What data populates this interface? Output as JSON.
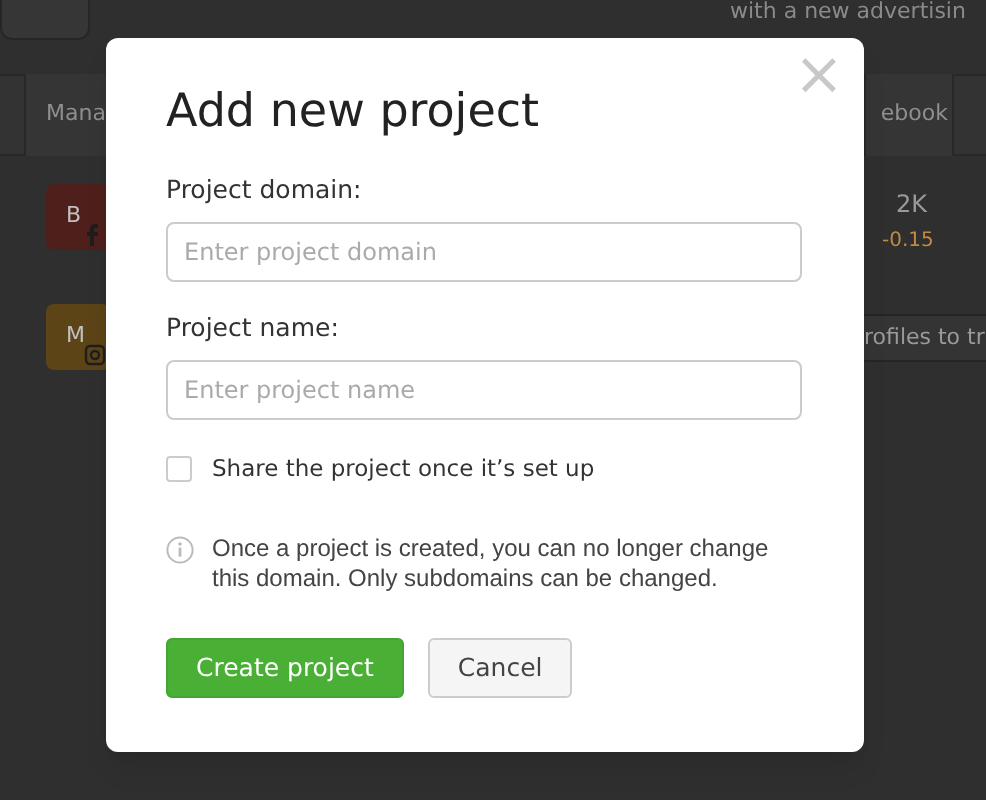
{
  "background": {
    "banner_text": "with a new advertisin",
    "tabs": [
      "Mana",
      "ebook"
    ],
    "rows": [
      {
        "badge": "B",
        "color": "#4f201b",
        "kind": "facebook",
        "value": "2K",
        "change": "-0.15"
      },
      {
        "badge": "M",
        "color": "#5c4417",
        "kind": "instagram",
        "button": "rofiles to tr"
      }
    ]
  },
  "dialog": {
    "title": "Add new project",
    "close": "×",
    "fields": [
      {
        "label": "Project domain:",
        "placeholder": "Enter project domain"
      },
      {
        "label": "Project name:",
        "placeholder": "Enter project name"
      }
    ],
    "share": {
      "label": "Share the project once it’s set up",
      "checked": false
    },
    "note": "Once a project is created, you can no longer change this domain. Only subdomains can be changed.",
    "buttons": [
      {
        "label": "Create project",
        "kind": "primary"
      },
      {
        "label": "Cancel",
        "kind": "secondary"
      }
    ]
  }
}
